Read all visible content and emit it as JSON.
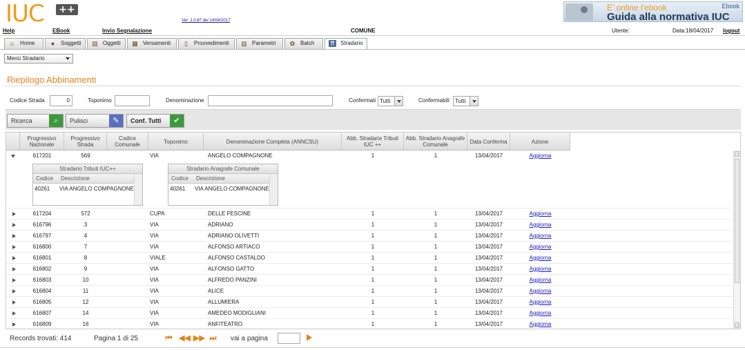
{
  "header": {
    "logo_text": "IUC",
    "logo_plus": "++",
    "version": "Ver. 1.0.87 del 14/04/2017",
    "banner_line1": "E' online l'ebook",
    "banner_line2": "Guida alla normativa IUC",
    "banner_badge": "Ebook"
  },
  "menubar": {
    "help": "Help",
    "ebook": "EBook",
    "invio": "Invio Segnalazione",
    "comune": "COMUNE",
    "utente": "Utente:",
    "data": "Data:18/04/2017",
    "logout": "logout"
  },
  "tabs": [
    {
      "label": "Home",
      "icon": "home-icon"
    },
    {
      "label": "Soggetti",
      "icon": "person-icon"
    },
    {
      "label": "Oggetti",
      "icon": "document-icon"
    },
    {
      "label": "Versamenti",
      "icon": "money-icon"
    },
    {
      "label": "Provvedimenti",
      "icon": "file-icon"
    },
    {
      "label": "Parametri",
      "icon": "grid-icon"
    },
    {
      "label": "Batch",
      "icon": "gear-icon"
    },
    {
      "label": "Stradario",
      "icon": "road-icon"
    }
  ],
  "menu_select": "Menù Stradario",
  "section_title": "Riepilogo Abbinamenti",
  "filters": {
    "codice_strada_label": "Codice Strada",
    "codice_strada_value": "0",
    "toponimo_label": "Toponimo",
    "toponimo_value": "",
    "denominazione_label": "Denominazione",
    "denominazione_value": "",
    "confermati_label": "Confermati",
    "confermati_value": "Tutti",
    "confermabili_label": "Confermabili",
    "confermabili_value": "Tutti"
  },
  "buttons": {
    "ricerca": "Ricerca",
    "pulisci": "Pulisci",
    "conf_tutti": "Conf. Tutti"
  },
  "table": {
    "headers": [
      "Progressivo Nazionale",
      "Progressivo Strada",
      "Codice Comunale",
      "Toponimo",
      "Denominazione Completa (ANNCSU)",
      "Abb. Stradario Tributi IUC ++",
      "Abb. Stradario Anagrafe Comunale",
      "Data Conferma",
      "Azione"
    ],
    "rows": [
      [
        "617201",
        "569",
        "",
        "VIA",
        "ANGELO COMPAGNONE",
        "1",
        "1",
        "13/04/2017",
        "Aggiorna"
      ],
      [
        "617204",
        "572",
        "",
        "CUPA",
        "DELLE FESCINE",
        "1",
        "1",
        "13/04/2017",
        "Aggiorna"
      ],
      [
        "616796",
        "3",
        "",
        "VIA",
        "ADRIANO",
        "1",
        "1",
        "13/04/2017",
        "Aggiorna"
      ],
      [
        "616797",
        "4",
        "",
        "VIA",
        "ADRIANO OLIVETTI",
        "1",
        "1",
        "13/04/2017",
        "Aggiorna"
      ],
      [
        "616800",
        "7",
        "",
        "VIA",
        "ALFONSO ARTIACO",
        "1",
        "1",
        "13/04/2017",
        "Aggiorna"
      ],
      [
        "616801",
        "8",
        "",
        "VIALE",
        "ALFONSO CASTALDO",
        "1",
        "1",
        "13/04/2017",
        "Aggiorna"
      ],
      [
        "616802",
        "9",
        "",
        "VIA",
        "ALFONSO GATTO",
        "1",
        "1",
        "13/04/2017",
        "Aggiorna"
      ],
      [
        "616803",
        "10",
        "",
        "VIA",
        "ALFREDO PANZINI",
        "1",
        "1",
        "13/04/2017",
        "Aggiorna"
      ],
      [
        "616804",
        "11",
        "",
        "VIA",
        "ALICE",
        "1",
        "1",
        "13/04/2017",
        "Aggiorna"
      ],
      [
        "616805",
        "12",
        "",
        "VIA",
        "ALLUMIERA",
        "1",
        "1",
        "13/04/2017",
        "Aggiorna"
      ],
      [
        "616807",
        "14",
        "",
        "VIA",
        "AMEDEO MODIGLIANI",
        "1",
        "1",
        "13/04/2017",
        "Aggiorna"
      ],
      [
        "616809",
        "16",
        "",
        "VIA",
        "ANFITEATRO",
        "1",
        "1",
        "13/04/2017",
        "Aggiorna"
      ]
    ],
    "sub_tributi": {
      "title": "Stradario Tributi IUC++",
      "col1": "Codice",
      "col2": "Descrizione",
      "code": "40261",
      "desc": "VIA ANGELO COMPAGNONE"
    },
    "sub_anagrafe": {
      "title": "Stradario Anagrafe Comunale",
      "col1": "Codice",
      "col2": "Descrizione",
      "code": "40261",
      "desc": "VIA ANGELO COMPAGNONE"
    }
  },
  "footer": {
    "records": "Records trovati: 414",
    "pagina": "Pagina 1 di 25",
    "vai": "vai a pagina"
  }
}
